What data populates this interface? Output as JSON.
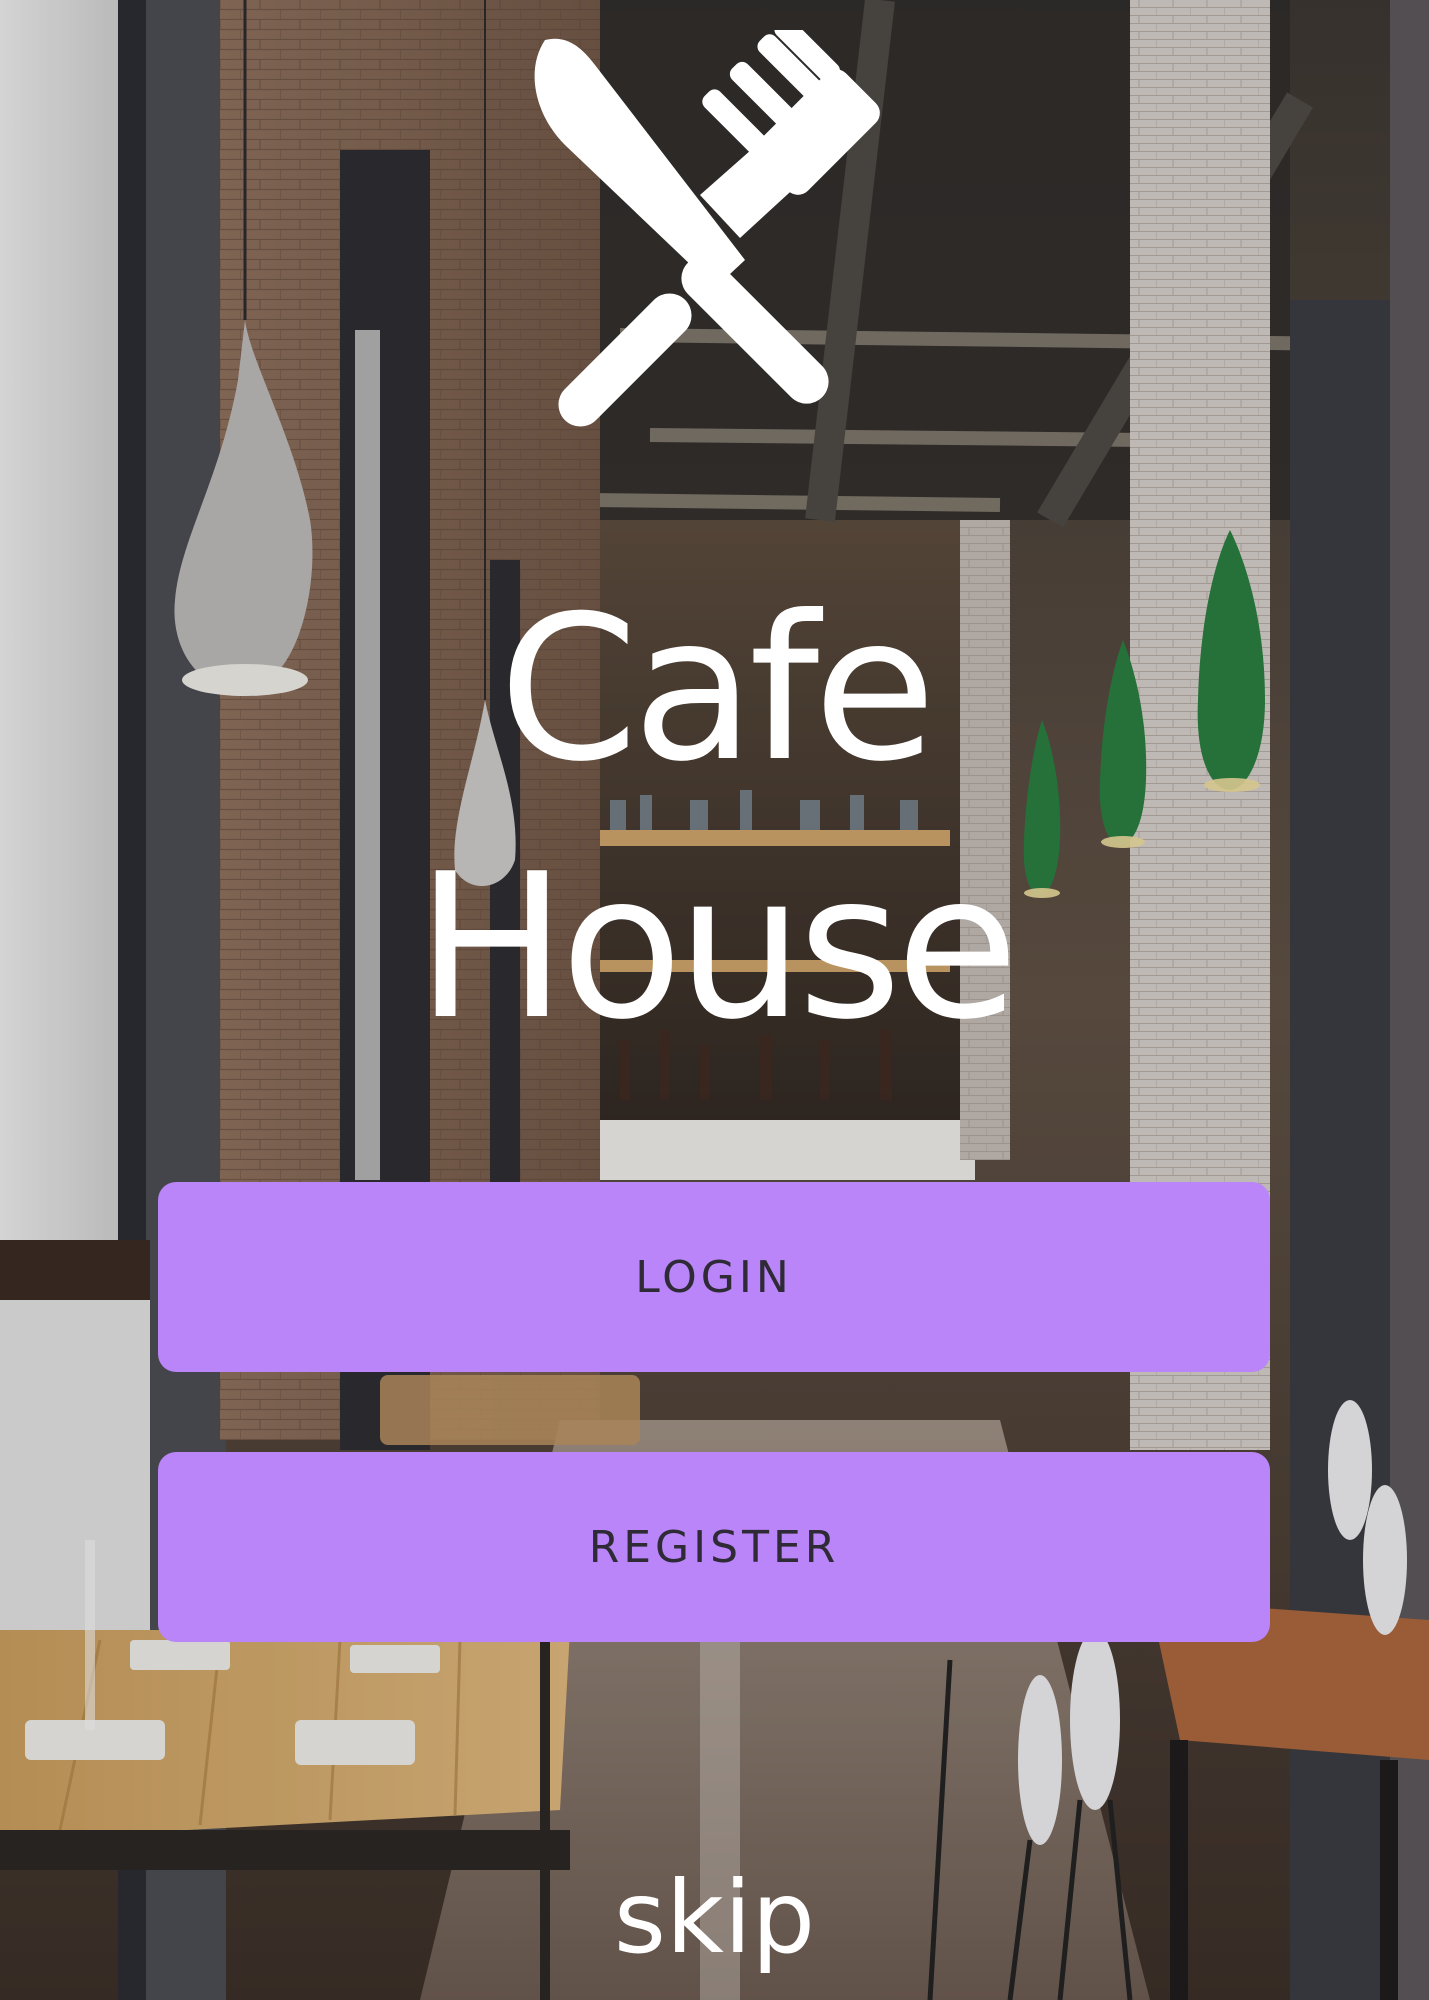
{
  "app": {
    "title_line1": "Cafe",
    "title_line2": "House"
  },
  "logo": {
    "icon": "knife-fork-crossed-icon",
    "color": "#ffffff"
  },
  "background": {
    "description_icon": "cafe-interior-photo"
  },
  "actions": {
    "login_label": "LOGIN",
    "register_label": "REGISTER",
    "skip_label": "skip"
  },
  "colors": {
    "button_bg": "#b985f8",
    "button_text": "#2e2a36",
    "title_text": "#ffffff"
  }
}
